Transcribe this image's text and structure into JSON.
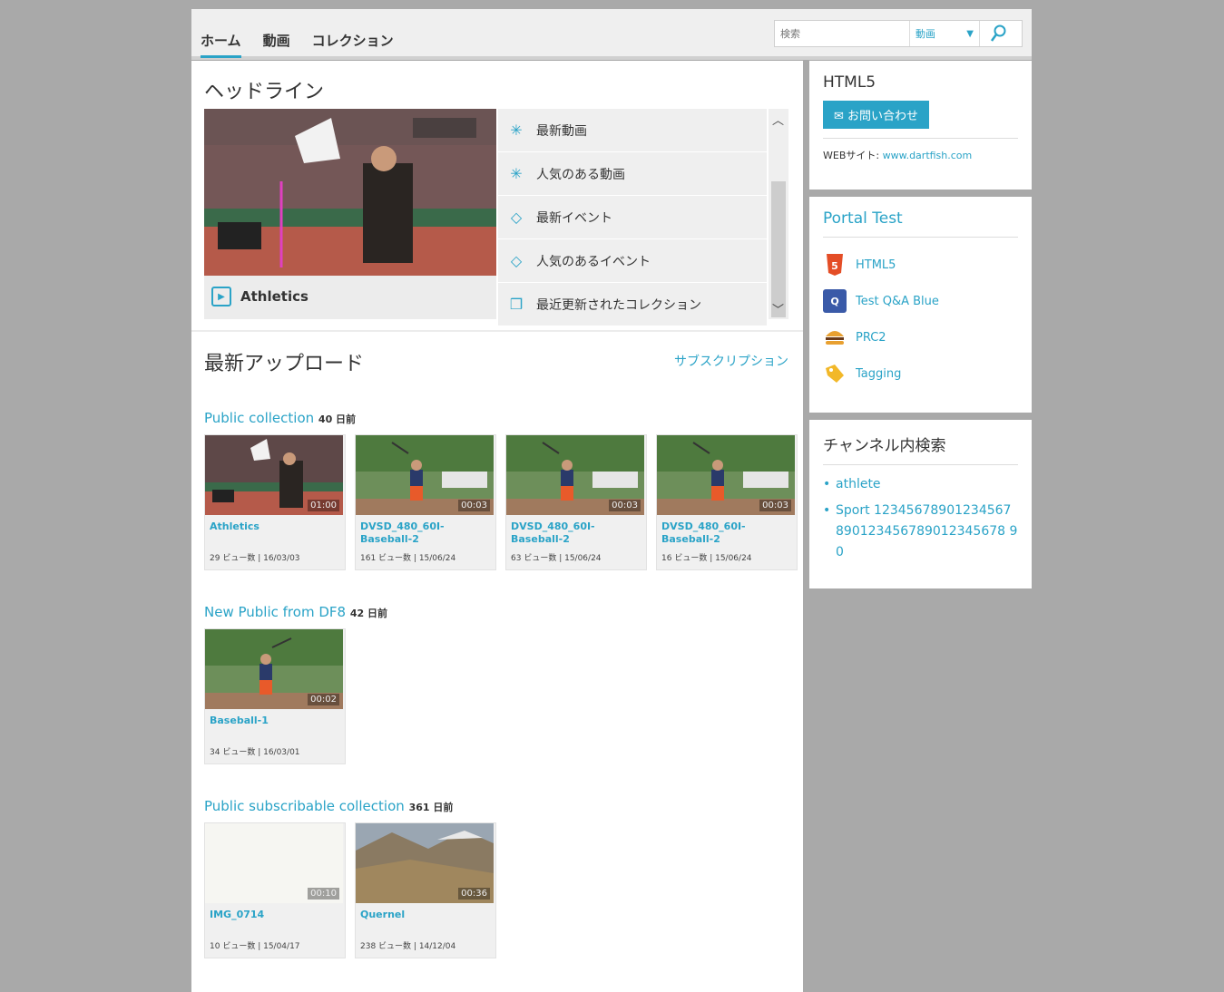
{
  "nav": {
    "tabs": [
      {
        "label": "ホーム",
        "active": true
      },
      {
        "label": "動画",
        "active": false
      },
      {
        "label": "コレクション",
        "active": false
      }
    ]
  },
  "search": {
    "placeholder": "検索",
    "scope": "動画"
  },
  "headline": {
    "title": "ヘッドライン",
    "video_caption": "Athletics",
    "items": [
      {
        "label": "最新動画",
        "icon": "sparkle-icon"
      },
      {
        "label": "人気のある動画",
        "icon": "sparkle-icon"
      },
      {
        "label": "最新イベント",
        "icon": "tag-icon"
      },
      {
        "label": "人気のあるイベント",
        "icon": "tag-icon"
      },
      {
        "label": "最近更新されたコレクション",
        "icon": "collection-icon"
      }
    ]
  },
  "uploads": {
    "title": "最新アップロード",
    "subscription_link": "サブスクリプション",
    "collections": [
      {
        "name": "Public collection",
        "age": "40 日前",
        "videos": [
          {
            "title": "Athletics",
            "duration": "01:00",
            "views": "29 ビュー数",
            "date": "16/03/03",
            "thumb": "athletics"
          },
          {
            "title": "DVSD_480_60I-Baseball-2",
            "duration": "00:03",
            "views": "161 ビュー数",
            "date": "15/06/24",
            "thumb": "baseball"
          },
          {
            "title": "DVSD_480_60I-Baseball-2",
            "duration": "00:03",
            "views": "63 ビュー数",
            "date": "15/06/24",
            "thumb": "baseball"
          },
          {
            "title": "DVSD_480_60I-Baseball-2",
            "duration": "00:03",
            "views": "16 ビュー数",
            "date": "15/06/24",
            "thumb": "baseball"
          }
        ]
      },
      {
        "name": "New Public from DF8",
        "age": "42 日前",
        "videos": [
          {
            "title": "Baseball-1",
            "duration": "00:02",
            "views": "34 ビュー数",
            "date": "16/03/01",
            "thumb": "baseball"
          }
        ]
      },
      {
        "name": "Public subscribable collection",
        "age": "361 日前",
        "videos": [
          {
            "title": "IMG_0714",
            "duration": "00:10",
            "views": "10 ビュー数",
            "date": "15/04/17",
            "thumb": "blank"
          },
          {
            "title": "Quernel",
            "duration": "00:36",
            "views": "238 ビュー数",
            "date": "14/12/04",
            "thumb": "mountain"
          }
        ]
      }
    ]
  },
  "sidebar": {
    "channel": {
      "title": "HTML5",
      "contact_label": "お問い合わせ",
      "website_label": "WEBサイト:",
      "website_url": "www.dartfish.com"
    },
    "portal": {
      "title": "Portal Test",
      "items": [
        {
          "label": "HTML5",
          "icon": "html5-icon"
        },
        {
          "label": "Test Q&A Blue",
          "icon": "qa-icon"
        },
        {
          "label": "PRC2",
          "icon": "burger-icon"
        },
        {
          "label": "Tagging",
          "icon": "tag-icon"
        }
      ]
    },
    "channel_search": {
      "title": "チャンネル内検索",
      "items": [
        "athlete",
        "Sport 12345678901234567890123456789012345678 90"
      ]
    }
  },
  "colors": {
    "accent": "#2aa3c7",
    "background": "#a9a9a9"
  }
}
